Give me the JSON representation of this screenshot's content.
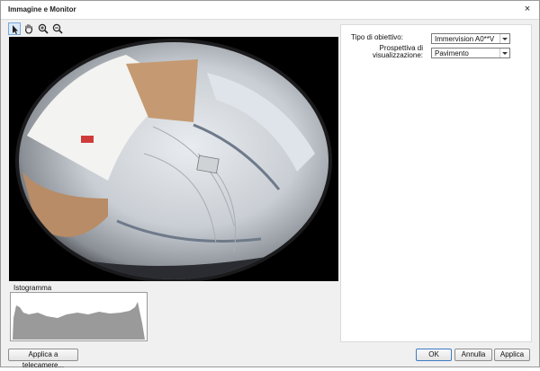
{
  "window": {
    "title": "Immagine e Monitor",
    "close_glyph": "×"
  },
  "toolbar": {
    "tools": [
      {
        "icon": "pointer-icon",
        "selected": true
      },
      {
        "icon": "hand-icon",
        "selected": false
      },
      {
        "icon": "zoom-in-icon",
        "selected": false
      },
      {
        "icon": "zoom-out-icon",
        "selected": false
      }
    ]
  },
  "histogram": {
    "label": "Istogramma",
    "fill_color": "#9a9a9a"
  },
  "settings": {
    "lens_type": {
      "label": "Tipo di obiettivo:",
      "value": "Immervision A0**V"
    },
    "view_perspective": {
      "label": "Prospettiva di visualizzazione:",
      "value": "Pavimento"
    }
  },
  "buttons": {
    "apply_to_cameras": "Applica a telecamere...",
    "ok": "OK",
    "cancel": "Annulla",
    "apply": "Applica"
  }
}
